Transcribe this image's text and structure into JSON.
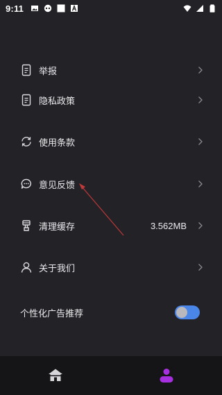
{
  "statusbar": {
    "time": "9:11",
    "left_icons": [
      "image-icon",
      "game-controller-icon",
      "square-icon",
      "font-a-icon"
    ],
    "right_icons": [
      "wifi-icon",
      "signal-icon",
      "battery-icon"
    ]
  },
  "menu": {
    "items": [
      {
        "label": "举报",
        "icon": "document-icon",
        "value": ""
      },
      {
        "label": "隐私政策",
        "icon": "document-icon",
        "value": ""
      },
      {
        "label": "使用条款",
        "icon": "refresh-icon",
        "value": ""
      },
      {
        "label": "意见反馈",
        "icon": "chat-bubble-icon",
        "value": ""
      },
      {
        "label": "清理缓存",
        "icon": "brush-icon",
        "value": "3.562MB"
      },
      {
        "label": "关于我们",
        "icon": "person-icon",
        "value": ""
      }
    ]
  },
  "ad_setting": {
    "label": "个性化广告推荐",
    "enabled": true
  },
  "bottom_nav": {
    "items": [
      {
        "icon": "home-icon",
        "active": false
      },
      {
        "icon": "profile-icon",
        "active": true
      }
    ]
  },
  "colors": {
    "background": "#222227",
    "bottom_nav_bg": "#151518",
    "accent_purple": "#a62fe0",
    "toggle_track": "#4a86e8",
    "annotation_red": "#c0393b"
  }
}
